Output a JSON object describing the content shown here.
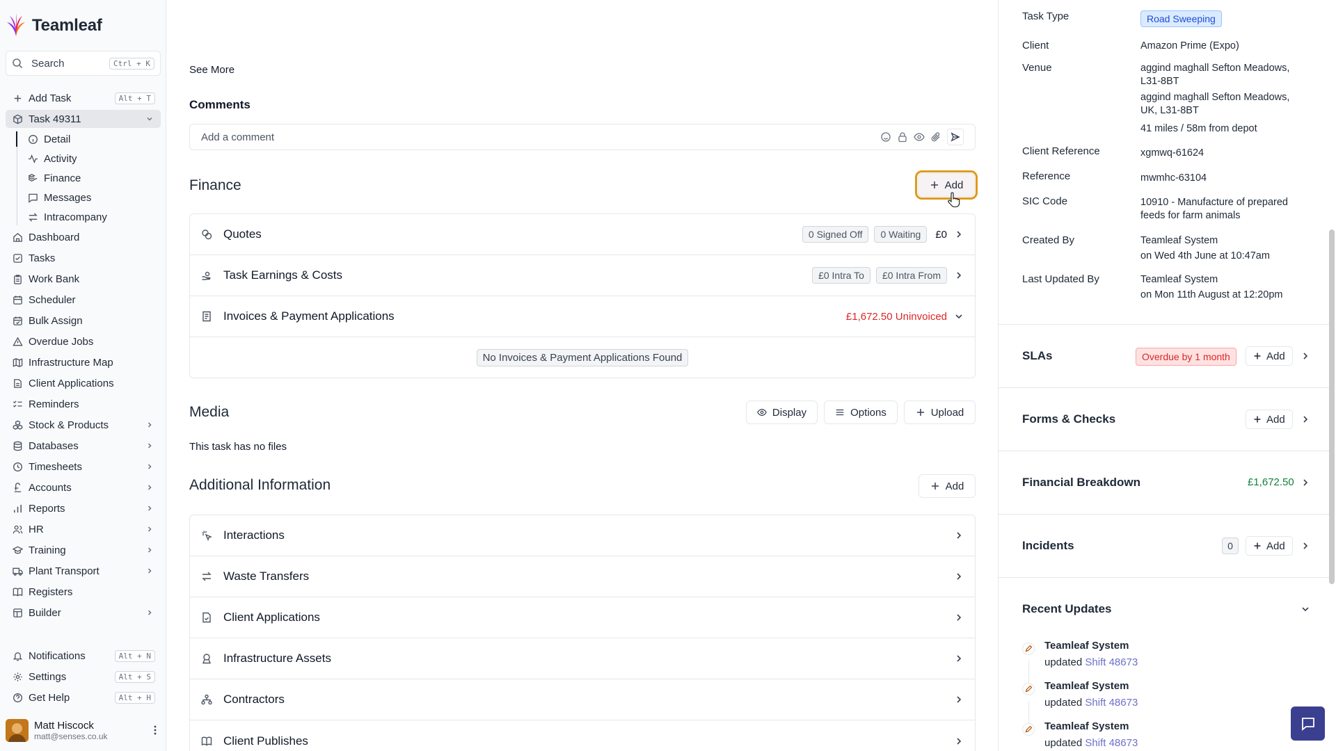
{
  "brand": {
    "name": "Teamleaf"
  },
  "search": {
    "label": "Search",
    "shortcut": "Ctrl + K"
  },
  "sidebar": {
    "add_task": {
      "label": "Add Task",
      "shortcut": "Alt + T"
    },
    "task": {
      "label": "Task 49311"
    },
    "sub_items": [
      {
        "label": "Detail",
        "icon": "info-icon"
      },
      {
        "label": "Activity",
        "icon": "activity-icon"
      },
      {
        "label": "Finance",
        "icon": "coins-icon"
      },
      {
        "label": "Messages",
        "icon": "message-icon"
      },
      {
        "label": "Intracompany",
        "icon": "arrows-icon"
      }
    ],
    "items": [
      {
        "label": "Dashboard"
      },
      {
        "label": "Tasks"
      },
      {
        "label": "Work Bank"
      },
      {
        "label": "Scheduler"
      },
      {
        "label": "Bulk Assign"
      },
      {
        "label": "Overdue Jobs"
      },
      {
        "label": "Infrastructure Map"
      },
      {
        "label": "Client Applications"
      },
      {
        "label": "Reminders"
      },
      {
        "label": "Stock & Products"
      },
      {
        "label": "Databases"
      },
      {
        "label": "Timesheets"
      },
      {
        "label": "Accounts"
      },
      {
        "label": "Reports"
      },
      {
        "label": "HR"
      },
      {
        "label": "Training"
      },
      {
        "label": "Plant Transport"
      },
      {
        "label": "Registers"
      },
      {
        "label": "Builder"
      }
    ],
    "bottom": [
      {
        "label": "Notifications",
        "shortcut": "Alt + N"
      },
      {
        "label": "Settings",
        "shortcut": "Alt + S"
      },
      {
        "label": "Get Help",
        "shortcut": "Alt + H"
      }
    ],
    "user": {
      "name": "Matt Hiscock",
      "email": "matt@senses.co.uk"
    }
  },
  "main": {
    "see_more": "See More",
    "comments": {
      "title": "Comments",
      "placeholder": "Add a comment"
    },
    "finance": {
      "title": "Finance",
      "add_label": "Add",
      "quotes": {
        "label": "Quotes",
        "signed_off": "0 Signed Off",
        "waiting": "0 Waiting",
        "amount": "£0"
      },
      "earnings": {
        "label": "Task Earnings & Costs",
        "intra_to": "£0 Intra To",
        "intra_from": "£0 Intra From"
      },
      "invoices": {
        "label": "Invoices & Payment Applications",
        "uninvoiced": "£1,672.50 Uninvoiced",
        "empty": "No Invoices & Payment Applications Found"
      }
    },
    "media": {
      "title": "Media",
      "display": "Display",
      "options": "Options",
      "upload": "Upload",
      "empty": "This task has no files"
    },
    "additional": {
      "title": "Additional Information",
      "add_label": "Add",
      "rows": [
        {
          "label": "Interactions"
        },
        {
          "label": "Waste Transfers"
        },
        {
          "label": "Client Applications"
        },
        {
          "label": "Infrastructure Assets"
        },
        {
          "label": "Contractors"
        },
        {
          "label": "Client Publishes"
        }
      ]
    }
  },
  "details": {
    "task_type": {
      "key": "Task Type",
      "value": "Road Sweeping"
    },
    "client": {
      "key": "Client",
      "value": "Amazon Prime (Expo)"
    },
    "venue": {
      "key": "Venue",
      "line1": "aggind maghall Sefton Meadows, L31-8BT",
      "line2": "aggind maghall Sefton Meadows, UK, L31-8BT",
      "distance": "41 miles / 58m from depot"
    },
    "client_reference": {
      "key": "Client Reference",
      "value": "xgmwq-61624"
    },
    "reference": {
      "key": "Reference",
      "value": "mwmhc-63104"
    },
    "sic_code": {
      "key": "SIC Code",
      "value": "10910 - Manufacture of prepared feeds for farm animals"
    },
    "created_by": {
      "key": "Created By",
      "name": "Teamleaf System",
      "when": "on Wed 4th June at 10:47am"
    },
    "last_updated_by": {
      "key": "Last Updated By",
      "name": "Teamleaf System",
      "when": "on Mon 11th August at 12:20pm"
    }
  },
  "panels": {
    "slas": {
      "title": "SLAs",
      "badge": "Overdue by 1 month",
      "add_label": "Add"
    },
    "forms": {
      "title": "Forms & Checks",
      "add_label": "Add"
    },
    "financial": {
      "title": "Financial Breakdown",
      "amount": "£1,672.50"
    },
    "incidents": {
      "title": "Incidents",
      "count": "0",
      "add_label": "Add"
    },
    "recent": {
      "title": "Recent Updates",
      "items": [
        {
          "who": "Teamleaf System",
          "verb": "updated",
          "target": "Shift 48673"
        },
        {
          "who": "Teamleaf System",
          "verb": "updated",
          "target": "Shift 48673"
        },
        {
          "who": "Teamleaf System",
          "verb": "updated",
          "target": "Shift 48673"
        }
      ]
    }
  },
  "colors": {
    "accent": "#3b3f8f",
    "highlight": "#e09a1a",
    "danger": "#dc2626",
    "success": "#15803d",
    "link": "#6d6fc9"
  }
}
